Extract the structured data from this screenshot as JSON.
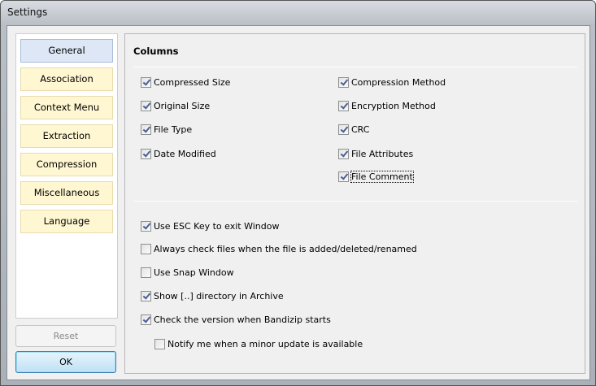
{
  "window": {
    "title": "Settings"
  },
  "sidebar": {
    "items": [
      {
        "label": "General",
        "active": true
      },
      {
        "label": "Association"
      },
      {
        "label": "Context Menu"
      },
      {
        "label": "Extraction"
      },
      {
        "label": "Compression"
      },
      {
        "label": "Miscellaneous"
      },
      {
        "label": "Language"
      }
    ]
  },
  "buttons": {
    "reset": "Reset",
    "ok": "OK"
  },
  "columns": {
    "header": "Columns",
    "left": [
      {
        "label": "Compressed Size",
        "checked": true
      },
      {
        "label": "Original Size",
        "checked": true
      },
      {
        "label": "File Type",
        "checked": true
      },
      {
        "label": "Date Modified",
        "checked": true
      }
    ],
    "right": [
      {
        "label": "Compression Method",
        "checked": true
      },
      {
        "label": "Encryption Method",
        "checked": true
      },
      {
        "label": "CRC",
        "checked": true
      },
      {
        "label": "File Attributes",
        "checked": true
      },
      {
        "label": "File Comment",
        "checked": true
      }
    ]
  },
  "options": [
    {
      "label": "Use ESC Key to exit Window",
      "checked": true
    },
    {
      "label": "Always check files when the file is added/deleted/renamed",
      "checked": false
    },
    {
      "label": "Use Snap Window",
      "checked": false
    },
    {
      "label": "Show [..] directory in Archive",
      "checked": true
    },
    {
      "label": "Check the version when Bandizip starts",
      "checked": true
    },
    {
      "label": "Notify me when a minor update is available",
      "checked": false
    }
  ]
}
